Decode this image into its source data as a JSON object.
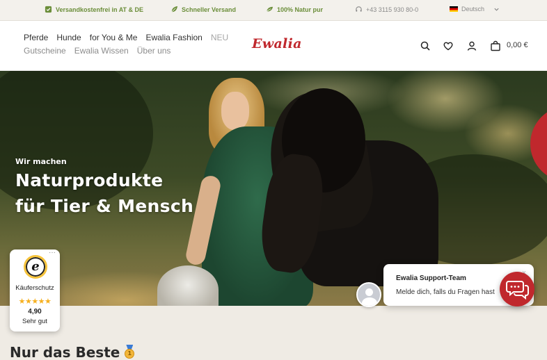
{
  "topbar": {
    "items": [
      {
        "label": "Versandkostenfrei in AT & DE",
        "icon": "check-badge-icon"
      },
      {
        "label": "Schneller Versand",
        "icon": "leaf-icon"
      },
      {
        "label": "100% Natur pur",
        "icon": "leaf-icon"
      },
      {
        "label": "+43 3115 930 80-0",
        "icon": "headset-icon"
      }
    ],
    "language": "Deutsch",
    "flag": "de-flag-icon"
  },
  "header": {
    "nav_primary": [
      "Pferde",
      "Hunde",
      "for You & Me",
      "Ewalia Fashion",
      "NEU"
    ],
    "nav_secondary": [
      "Gutscheine",
      "Ewalia Wissen",
      "Über uns"
    ],
    "logo": "Ewalia",
    "cart_total": "0,00 €",
    "icons": [
      "search-icon",
      "heart-icon",
      "user-icon",
      "cart-icon"
    ]
  },
  "hero": {
    "kicker": "Wir machen",
    "headline_line1": "Naturprodukte",
    "headline_line2": "für Tier & Mensch"
  },
  "section": {
    "title": "Nur das Beste"
  },
  "trusted_badge": {
    "seal_letter": "e",
    "label": "Käuferschutz",
    "stars": "★★★★★",
    "score": "4,90",
    "verdict": "Sehr gut"
  },
  "chat": {
    "title": "Ewalia Support-Team",
    "message": "Melde dich, falls du Fragen hast",
    "close": "×"
  },
  "colors": {
    "accent_red": "#c0282d",
    "accent_green": "#6b8e3a",
    "topbar_bg": "#f3f1ec",
    "section_bg": "#efebe4"
  }
}
